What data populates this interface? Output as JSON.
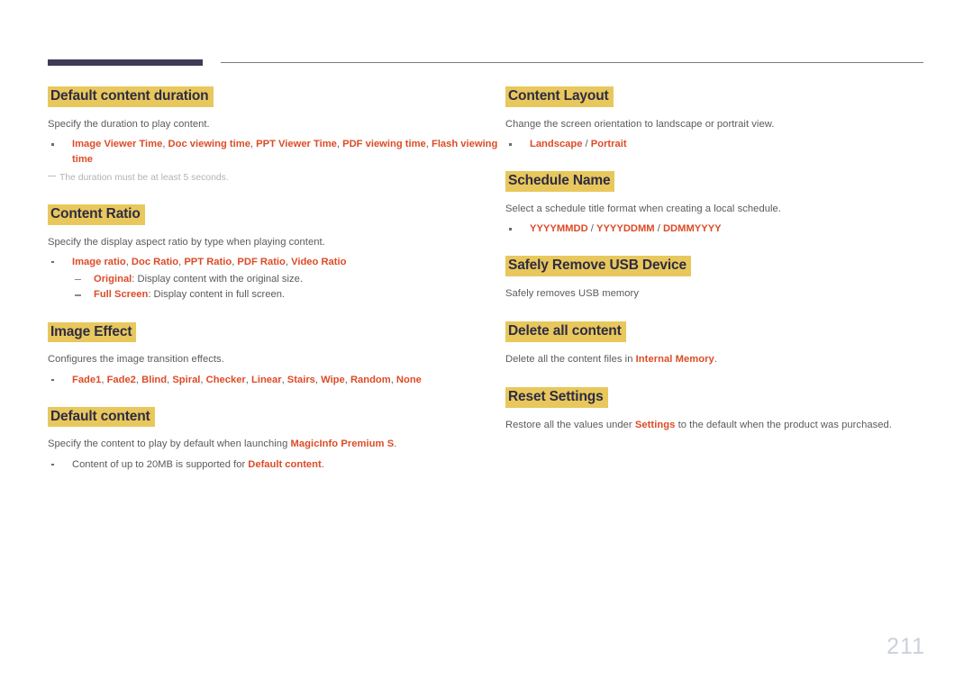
{
  "page": {
    "number": "211"
  },
  "colors": {
    "heading_highlight": "#e8c85c",
    "heading_text": "#2f2b44",
    "accent": "#dd4b26",
    "body_text": "#5a5a5a",
    "note_text": "#b3b3b3",
    "rule_thick": "#403a56",
    "rule_thin": "#7d7d7d",
    "page_number": "#ccd0dc"
  },
  "left_column": {
    "sections": [
      {
        "heading": "Default content duration",
        "desc": "Specify the duration to play content.",
        "bullet": {
          "parts": [
            {
              "text": "Image Viewer Time",
              "accent": true
            },
            {
              "text": ", ",
              "accent": false
            },
            {
              "text": "Doc viewing time",
              "accent": true
            },
            {
              "text": ", ",
              "accent": false
            },
            {
              "text": "PPT Viewer Time",
              "accent": true
            },
            {
              "text": ", ",
              "accent": false
            },
            {
              "text": "PDF viewing time",
              "accent": true
            },
            {
              "text": ", ",
              "accent": false
            },
            {
              "text": "Flash viewing time",
              "accent": true
            }
          ]
        },
        "note": "The duration must be at least 5 seconds."
      },
      {
        "heading": "Content Ratio",
        "desc": "Specify the display aspect ratio by type when playing content.",
        "bullet": {
          "parts": [
            {
              "text": "Image ratio",
              "accent": true
            },
            {
              "text": ", ",
              "accent": false
            },
            {
              "text": "Doc Ratio",
              "accent": true
            },
            {
              "text": ", ",
              "accent": false
            },
            {
              "text": "PPT Ratio",
              "accent": true
            },
            {
              "text": ", ",
              "accent": false
            },
            {
              "text": "PDF Ratio",
              "accent": true
            },
            {
              "text": ", ",
              "accent": false
            },
            {
              "text": "Video Ratio",
              "accent": true
            }
          ]
        },
        "sub_items": [
          {
            "term": "Original",
            "desc": ": Display content with the original size."
          },
          {
            "term": "Full Screen",
            "desc": ": Display content in full screen."
          }
        ]
      },
      {
        "heading": "Image Effect",
        "desc": "Configures the image transition effects.",
        "bullet": {
          "parts": [
            {
              "text": "Fade1",
              "accent": true
            },
            {
              "text": ", ",
              "accent": false
            },
            {
              "text": "Fade2",
              "accent": true
            },
            {
              "text": ", ",
              "accent": false
            },
            {
              "text": "Blind",
              "accent": true
            },
            {
              "text": ", ",
              "accent": false
            },
            {
              "text": "Spiral",
              "accent": true
            },
            {
              "text": ", ",
              "accent": false
            },
            {
              "text": "Checker",
              "accent": true
            },
            {
              "text": ", ",
              "accent": false
            },
            {
              "text": "Linear",
              "accent": true
            },
            {
              "text": ", ",
              "accent": false
            },
            {
              "text": "Stairs",
              "accent": true
            },
            {
              "text": ", ",
              "accent": false
            },
            {
              "text": "Wipe",
              "accent": true
            },
            {
              "text": ", ",
              "accent": false
            },
            {
              "text": "Random",
              "accent": true
            },
            {
              "text": ", ",
              "accent": false
            },
            {
              "text": "None",
              "accent": true
            }
          ]
        }
      },
      {
        "heading": "Default content",
        "desc_parts": [
          {
            "text": "Specify the content to play by default when launching ",
            "accent": false
          },
          {
            "text": "MagicInfo Premium S",
            "accent": true
          },
          {
            "text": ".",
            "accent": false
          }
        ],
        "bullet": {
          "parts": [
            {
              "text": "Content of up to 20MB is supported for ",
              "accent": false
            },
            {
              "text": "Default content",
              "accent": true
            },
            {
              "text": ".",
              "accent": false
            }
          ]
        }
      }
    ]
  },
  "right_column": {
    "sections": [
      {
        "heading": "Content Layout",
        "desc": "Change the screen orientation to landscape or portrait view.",
        "bullet": {
          "parts": [
            {
              "text": "Landscape",
              "accent": true
            },
            {
              "text": " / ",
              "accent": false
            },
            {
              "text": "Portrait",
              "accent": true
            }
          ]
        }
      },
      {
        "heading": "Schedule Name",
        "desc": "Select a schedule title format when creating a local schedule.",
        "bullet": {
          "parts": [
            {
              "text": "YYYYMMDD",
              "accent": true
            },
            {
              "text": " / ",
              "accent": false
            },
            {
              "text": "YYYYDDMM",
              "accent": true
            },
            {
              "text": " / ",
              "accent": false
            },
            {
              "text": "DDMMYYYY",
              "accent": true
            }
          ]
        }
      },
      {
        "heading": "Safely Remove USB Device",
        "desc": "Safely removes USB memory"
      },
      {
        "heading": "Delete all content",
        "desc_parts": [
          {
            "text": "Delete all the content files in ",
            "accent": false
          },
          {
            "text": "Internal Memory",
            "accent": true
          },
          {
            "text": ".",
            "accent": false
          }
        ]
      },
      {
        "heading": "Reset Settings",
        "desc_parts": [
          {
            "text": "Restore all the values under ",
            "accent": false
          },
          {
            "text": "Settings",
            "accent": true
          },
          {
            "text": " to the default when the product was purchased.",
            "accent": false
          }
        ]
      }
    ]
  }
}
